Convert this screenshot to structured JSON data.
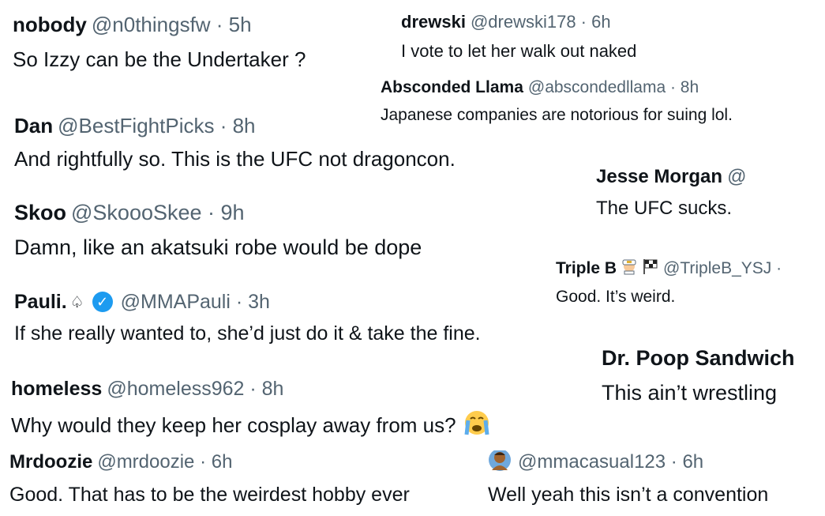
{
  "tweets": [
    {
      "name": "nobody",
      "meta": "@n0thingsfw · 5h",
      "text": "So Izzy can be the Undertaker ?"
    },
    {
      "name": "drewski",
      "meta": "@drewski178 · 6h",
      "text": "I vote to let her walk out naked"
    },
    {
      "name": "Absconded Llama",
      "meta": "@abscondedllama · 8h",
      "text": "Japanese companies are notorious for suing lol."
    },
    {
      "name": "Dan",
      "meta": "@BestFightPicks · 8h",
      "text": "And rightfully so. This is the UFC not dragoncon."
    },
    {
      "name": "Jesse Morgan",
      "meta": "@",
      "text": "The UFC sucks."
    },
    {
      "name": "Skoo",
      "meta": "@SkoooSkee · 9h",
      "text": "Damn, like an akatsuki robe would be dope"
    },
    {
      "name": "Triple B",
      "meta": "@TripleB_YSJ ·",
      "text": "Good. It’s weird.",
      "icons": [
        "pilot-emoji",
        "checkered-flag-emoji"
      ]
    },
    {
      "name": "Pauli.",
      "meta": "@MMAPauli · 3h",
      "text": "If she really wanted to, she’d just do it & take the fine.",
      "icons": [
        "spade-icon",
        "verified-badge-icon"
      ]
    },
    {
      "name": "Dr. Poop Sandwich",
      "meta": "",
      "text": "This ain’t wrestling"
    },
    {
      "name": "homeless",
      "meta": "@homeless962 · 8h",
      "text": "Why would they keep her cosplay away from us?",
      "icons": [
        "crying-face-emoji"
      ]
    },
    {
      "name": "Mrdoozie",
      "meta": "@mrdoozie · 6h",
      "text": "Good. That has to be the weirdest hobby ever"
    },
    {
      "name": "",
      "meta": "@mmacasual123 · 6h",
      "text": "Well yeah this isn’t a convention",
      "icons": [
        "person-emoji-avatar"
      ]
    }
  ],
  "colors": {
    "text": "#0f1419",
    "secondary": "#536471",
    "verified": "#1d9bf0"
  }
}
